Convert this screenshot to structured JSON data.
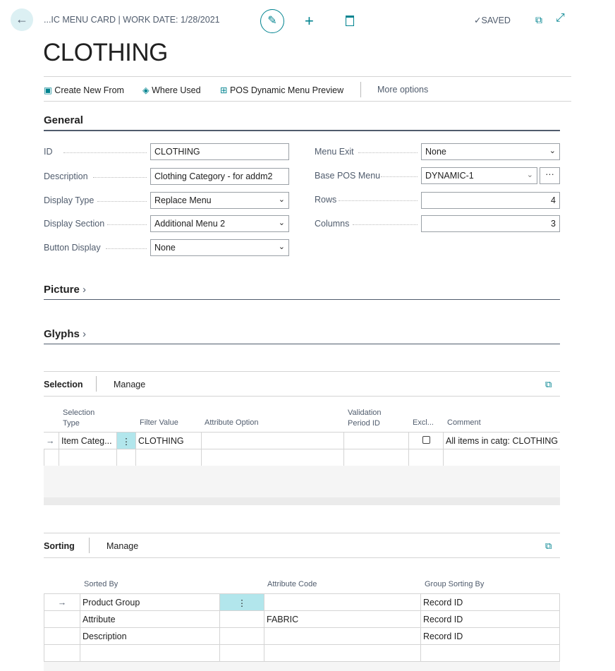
{
  "header": {
    "breadcrumb": "...IC MENU CARD | WORK DATE: 1/28/2021",
    "status": "SAVED",
    "title": "CLOTHING"
  },
  "actions": {
    "create_new_from": "Create New From",
    "where_used": "Where Used",
    "pos_preview": "POS Dynamic Menu Preview",
    "more": "More options"
  },
  "general": {
    "title": "General",
    "id_label": "ID",
    "id": "CLOTHING",
    "description_label": "Description",
    "description": "Clothing Category - for addm2",
    "display_type_label": "Display Type",
    "display_type": "Replace Menu",
    "display_section_label": "Display Section",
    "display_section": "Additional Menu 2",
    "button_display_label": "Button Display",
    "button_display": "None",
    "menu_exit_label": "Menu Exit",
    "menu_exit": "None",
    "base_pos_menu_label": "Base POS Menu",
    "base_pos_menu": "DYNAMIC-1",
    "rows_label": "Rows",
    "rows": "4",
    "columns_label": "Columns",
    "columns": "3"
  },
  "picture": {
    "title": "Picture"
  },
  "glyphs": {
    "title": "Glyphs"
  },
  "selection": {
    "title": "Selection",
    "manage": "Manage",
    "headers": {
      "type1": "Selection",
      "type2": "Type",
      "filter": "Filter Value",
      "attr": "Attribute Option",
      "val1": "Validation",
      "val2": "Period ID",
      "excl": "Excl...",
      "comment": "Comment"
    },
    "rows": [
      {
        "type": "Item Categ...",
        "filter": "CLOTHING",
        "attr": "",
        "validation": "",
        "excluded": false,
        "comment": "All items in catg: CLOTHING"
      }
    ]
  },
  "sorting": {
    "title": "Sorting",
    "manage": "Manage",
    "headers": {
      "sorted_by": "Sorted By",
      "attr": "Attribute Code",
      "group": "Group Sorting By"
    },
    "rows": [
      {
        "sorted_by": "Product Group",
        "attr": "",
        "group": "Record ID"
      },
      {
        "sorted_by": "Attribute",
        "attr": "FABRIC",
        "group": "Record ID"
      },
      {
        "sorted_by": "Description",
        "attr": "",
        "group": "Record ID"
      }
    ]
  }
}
